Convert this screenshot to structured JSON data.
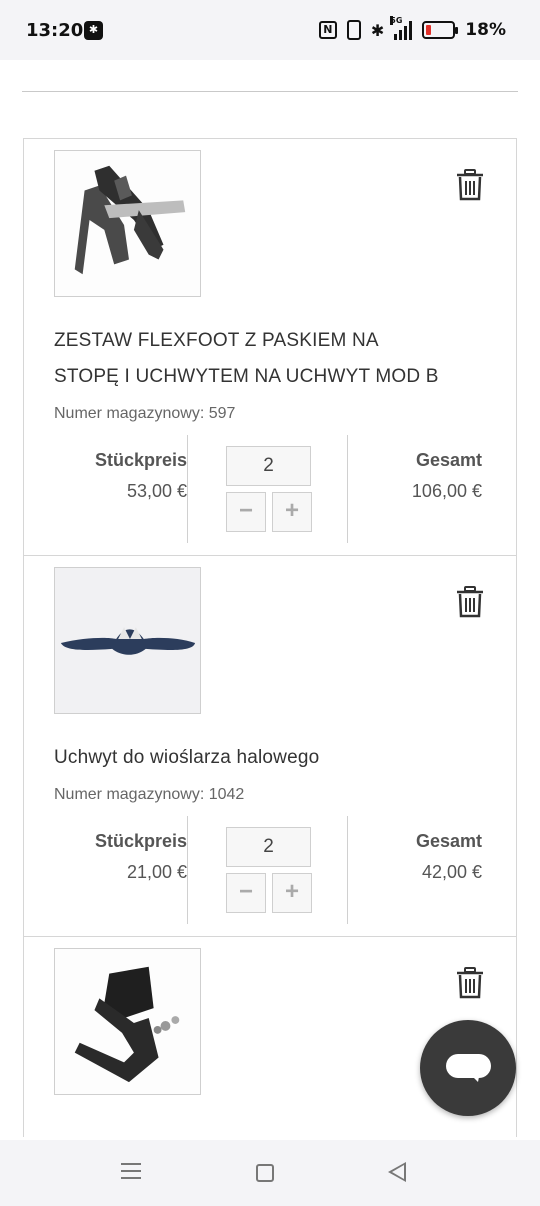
{
  "status_bar": {
    "time": "13:20",
    "battery_percent": "18%",
    "battery_level": 0.18,
    "network": "5G",
    "icons": [
      "app-notification-icon",
      "nfc-icon",
      "vibrate-icon",
      "bluetooth-icon",
      "signal-icon",
      "battery-icon"
    ]
  },
  "cart": {
    "items": [
      {
        "title": "ZESTAW FLEXFOOT Z PASKIEM NA STOPĘ I UCHWYTEM NA UCHWYT MOD B",
        "sku": "Numer magazynowy: 597",
        "unit_price_label": "Stückpreis",
        "unit_price": "53,00 €",
        "quantity": "2",
        "total_label": "Gesamt",
        "total": "106,00 €",
        "image": "flexfoot-kit-image"
      },
      {
        "title": "Uchwyt do wioślarza halowego",
        "sku": "Numer magazynowy: 1042",
        "unit_price_label": "Stückpreis",
        "unit_price": "21,00 €",
        "quantity": "2",
        "total_label": "Gesamt",
        "total": "42,00 €",
        "image": "rower-handle-image"
      },
      {
        "title": "",
        "sku": "",
        "image": "mount-bracket-image"
      }
    ],
    "minus_symbol": "−",
    "plus_symbol": "+"
  },
  "chat_button": {
    "icon": "chat-bubble-icon",
    "color": "#3a3a3a"
  },
  "nav_bar": {
    "icons": [
      "recent-apps-icon",
      "home-icon",
      "back-icon"
    ]
  }
}
